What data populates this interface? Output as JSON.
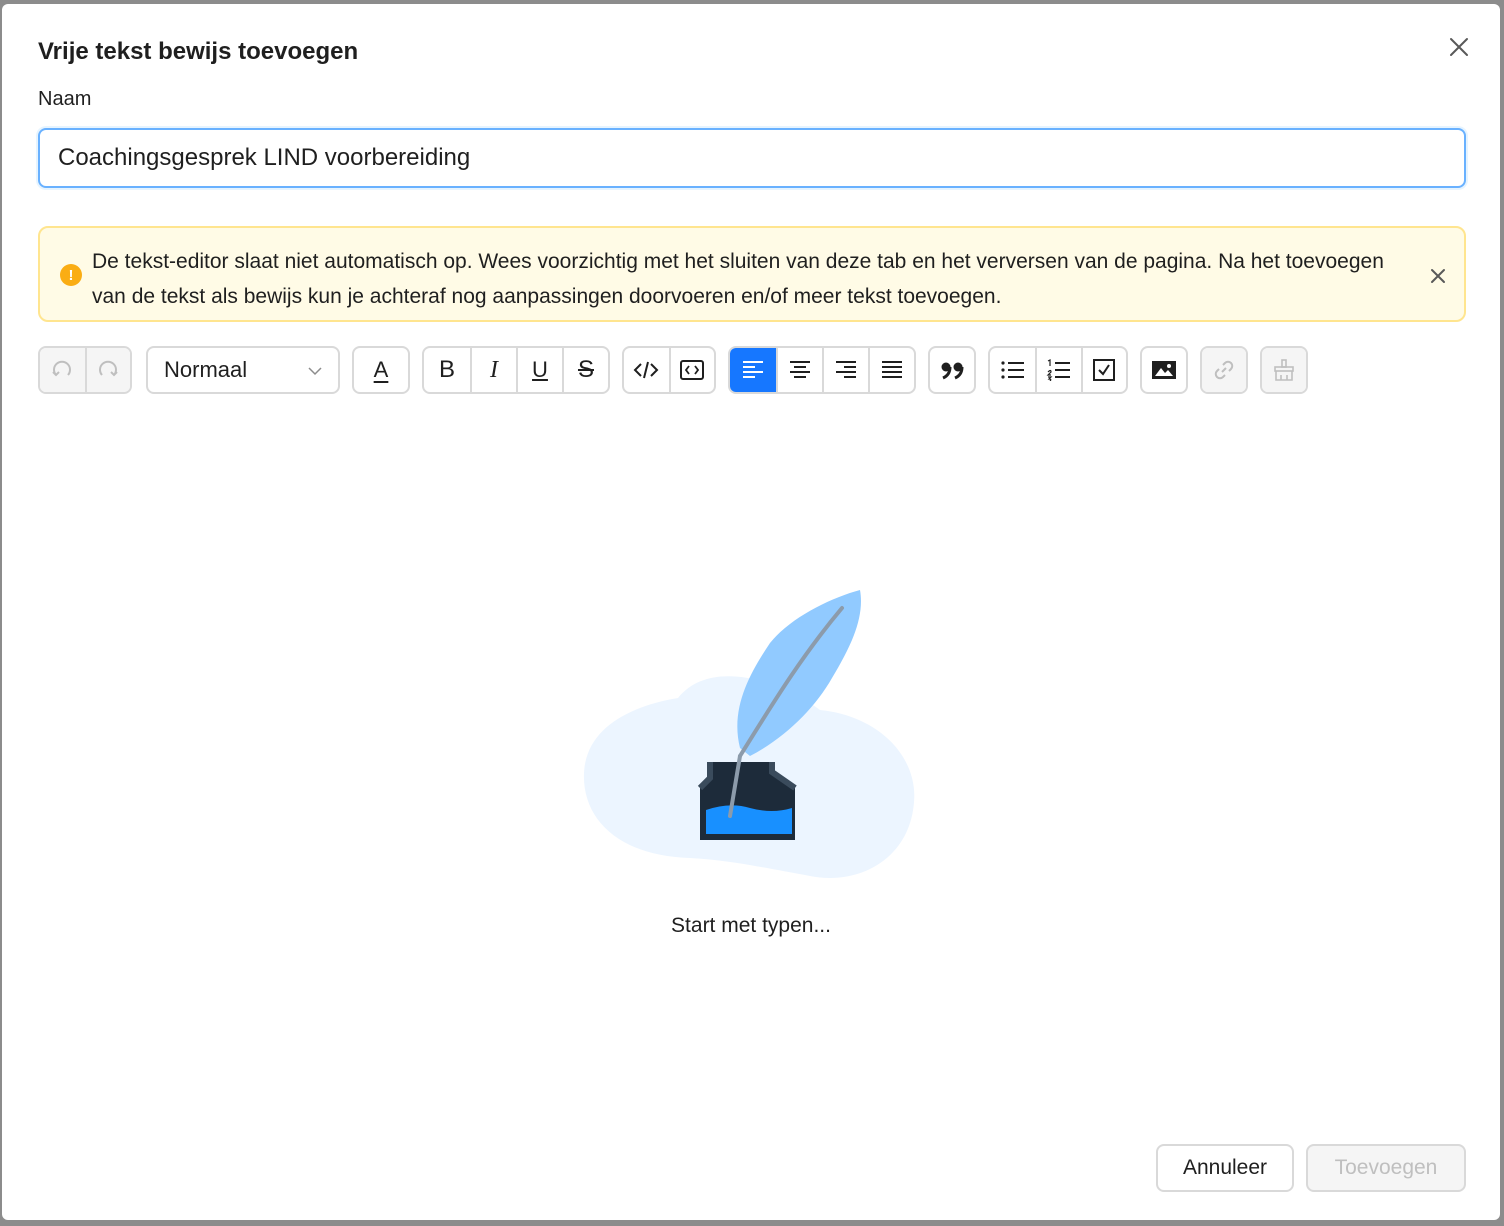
{
  "dialog": {
    "title": "Vrije tekst bewijs toevoegen",
    "close_icon": "close-icon"
  },
  "name_field": {
    "label": "Naam",
    "value": "Coachingsgesprek LIND voorbereiding"
  },
  "alert": {
    "icon": "exclamation-icon",
    "text": "De tekst-editor slaat niet automatisch op. Wees voorzichtig met het sluiten van deze tab en het verversen van de pagina. Na het toevoegen van de tekst als bewijs kun je achteraf nog aanpassingen doorvoeren en/of meer tekst toevoegen.",
    "close_icon": "close-icon"
  },
  "toolbar": {
    "block_format": "Normaal",
    "text_color_glyph": "A",
    "bold_glyph": "B",
    "italic_glyph": "I",
    "underline_glyph": "U",
    "strike_glyph": "S",
    "active_alignment": "align-left",
    "icons": [
      "undo-icon",
      "redo-icon",
      "chevron-down-icon",
      "text-color-icon",
      "bold-icon",
      "italic-icon",
      "underline-icon",
      "strikethrough-icon",
      "code-icon",
      "code-block-icon",
      "align-left-icon",
      "align-center-icon",
      "align-right-icon",
      "align-justify-icon",
      "quote-icon",
      "bullet-list-icon",
      "numbered-list-icon",
      "checklist-icon",
      "image-icon",
      "link-icon",
      "clear-format-icon"
    ]
  },
  "editor": {
    "placeholder": "Start met typen...",
    "illustration": "quill-inkwell-illustration"
  },
  "footer": {
    "cancel_label": "Annuleer",
    "submit_label": "Toevoegen"
  },
  "colors": {
    "primary": "#1677ff",
    "warning": "#faad14",
    "warning_bg": "#fffbe6",
    "warning_border": "#ffe58f",
    "feather": "#91caff",
    "ink": "#1890ff"
  }
}
